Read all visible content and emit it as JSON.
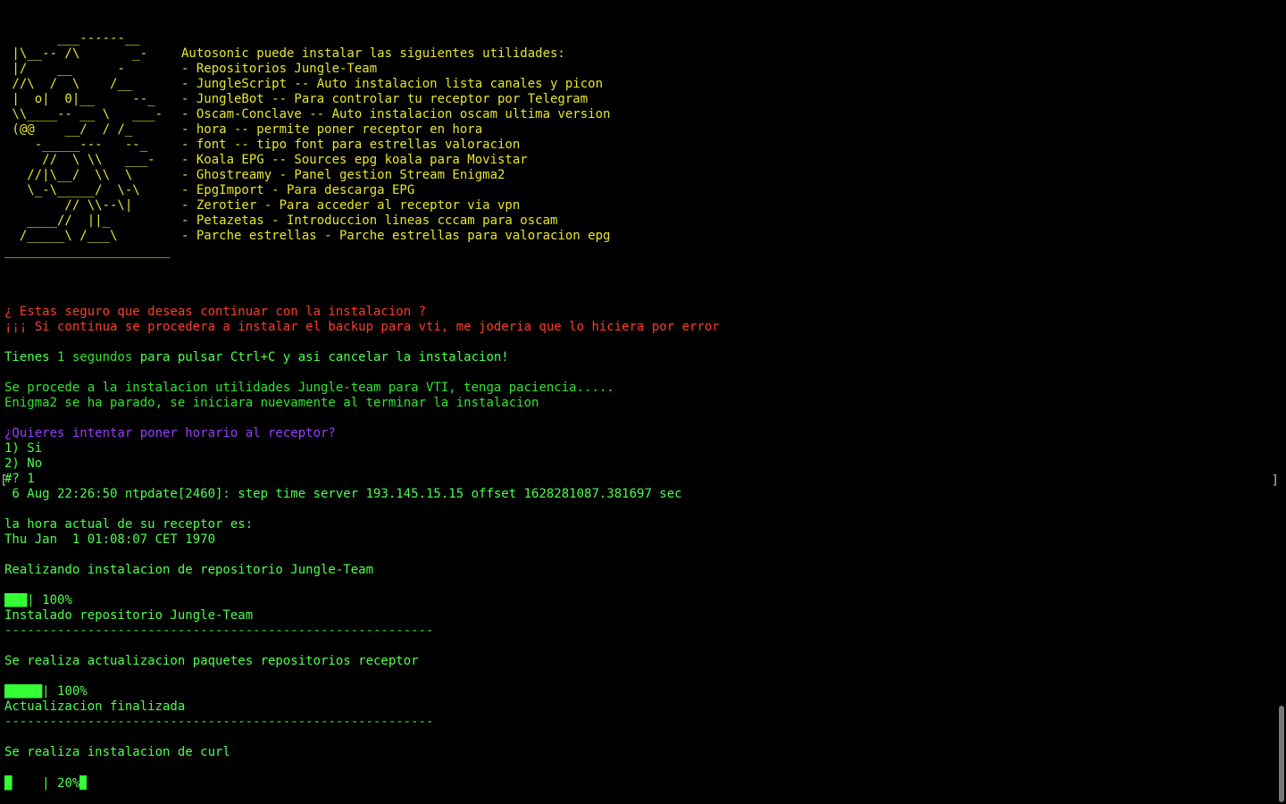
{
  "terminal": {
    "banner": [
      {
        "art": "       ___------__",
        "text": ""
      },
      {
        "art": " |\\__-- /\\       _-",
        "text": "Autosonic puede instalar las siguientes utilidades:"
      },
      {
        "art": " |/    __      -",
        "text": "- Repositorios Jungle-Team"
      },
      {
        "art": " //\\  /  \\    /__",
        "text": "- JungleScript -- Auto instalacion lista canales y picon"
      },
      {
        "art": " |  o|  0|__     --_",
        "text": "- JungleBot -- Para controlar tu receptor por Telegram"
      },
      {
        "art": " \\\\____-- __ \\   ___-",
        "text": "- Oscam-Conclave -- Auto instalacion oscam ultima version"
      },
      {
        "art": " (@@    __/  / /_",
        "text": "- hora -- permite poner receptor en hora"
      },
      {
        "art": "    -_____---   --_",
        "text": "- font -- tipo font para estrellas valoracion"
      },
      {
        "art": "     //  \\ \\\\   ___-",
        "text": "- Koala EPG -- Sources epg koala para Movistar"
      },
      {
        "art": "   //|\\__/  \\\\  \\",
        "text": "- Ghostreamy - Panel gestion Stream Enigma2"
      },
      {
        "art": "   \\_-\\_____/  \\-\\",
        "text": "- EpgImport - Para descarga EPG"
      },
      {
        "art": "        // \\\\--\\|",
        "text": "- Zerotier - Para acceder al receptor via vpn"
      },
      {
        "art": "   ____//  ||_",
        "text": "- Petazetas - Introduccion lineas cccam para oscam"
      },
      {
        "art": "  /_____\\ /___\\",
        "text": "- Parche estrellas - Parche estrellas para valoracion epg"
      }
    ],
    "separator_short": "______________________",
    "warning_1": "¿ Estas seguro que deseas continuar con la instalacion ?",
    "warning_2": "¡¡¡ Si continua se procedera a instalar el backup para vti, me joderia que lo hiciera por error",
    "countdown_prefix": "Tienes",
    "countdown_value": " 1 segundos",
    "countdown_suffix": " para pulsar Ctrl+C y asi cancelar la instalacion!",
    "proceed_1": "Se procede a la instalacion utilidades Jungle-team para VTI, tenga paciencia.....",
    "proceed_2": "Enigma2 se ha parado, se iniciara nuevamente al terminar la instalacion",
    "question": "¿Quieres intentar poner horario al receptor?",
    "option_1": "1) Si",
    "option_2": "2) No",
    "prompt": "#? 1",
    "ntp_line": " 6 Aug 22:26:50 ntpdate[2460]: step time server 193.145.15.15 offset 1628281087.381697 sec",
    "time_label": "la hora actual de su receptor es:",
    "time_value": "Thu Jan  1 01:08:07 CET 1970",
    "step1_title": "Realizando instalacion de repositorio Jungle-Team",
    "step1_bar": "███",
    "step1_pct": "| 100%",
    "step1_done": "Instalado repositorio Jungle-Team",
    "separator_long": "---------------------------------------------------------",
    "step2_title": "Se realiza actualizacion paquetes repositorios receptor",
    "step2_bar": "█████",
    "step2_pct": "| 100%",
    "step2_done": "Actualizacion finalizada",
    "step3_title": "Se realiza instalacion de curl",
    "step3_bar": "█",
    "step3_pct": "    | 20%",
    "progress": {
      "repo": 1.0,
      "update": 1.0,
      "curl": 0.2
    },
    "colors": {
      "background": "#000000",
      "green": "#33ff33",
      "yellow": "#e6e630",
      "red": "#ff3c28",
      "purple": "#9b3cff"
    }
  }
}
